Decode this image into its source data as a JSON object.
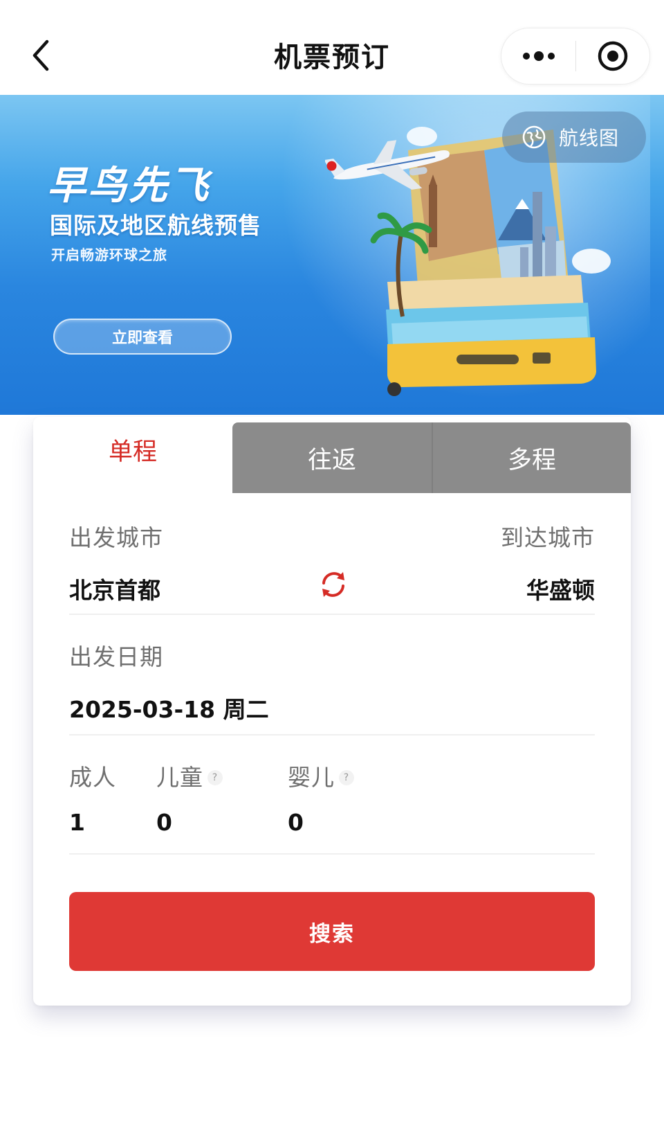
{
  "nav": {
    "title": "机票预订",
    "back_icon": "chevron-left-icon",
    "more_icon": "more-dots-icon",
    "close_icon": "target-circle-icon"
  },
  "banner": {
    "title": "早鸟先飞",
    "subtitle": "国际及地区航线预售",
    "description": "开启畅游环球之旅",
    "cta_label": "立即查看",
    "route_map_label": "航线图",
    "route_map_icon": "globe-route-icon"
  },
  "tabs": [
    {
      "label": "单程",
      "active": true
    },
    {
      "label": "往返",
      "active": false
    },
    {
      "label": "多程",
      "active": false
    }
  ],
  "form": {
    "departure_label": "出发城市",
    "departure_value": "北京首都",
    "arrival_label": "到达城市",
    "arrival_value": "华盛顿",
    "swap_icon": "swap-refresh-icon",
    "date_label": "出发日期",
    "date_value": "2025-03-18 周二",
    "adult_label": "成人",
    "adult_count": "1",
    "child_label": "儿童",
    "child_count": "0",
    "infant_label": "婴儿",
    "infant_count": "0",
    "help_mark": "?"
  },
  "search_label": "搜索",
  "colors": {
    "accent_red": "#df3935",
    "tab_inactive": "#8b8b8b",
    "banner_blue": "#2a86df"
  }
}
